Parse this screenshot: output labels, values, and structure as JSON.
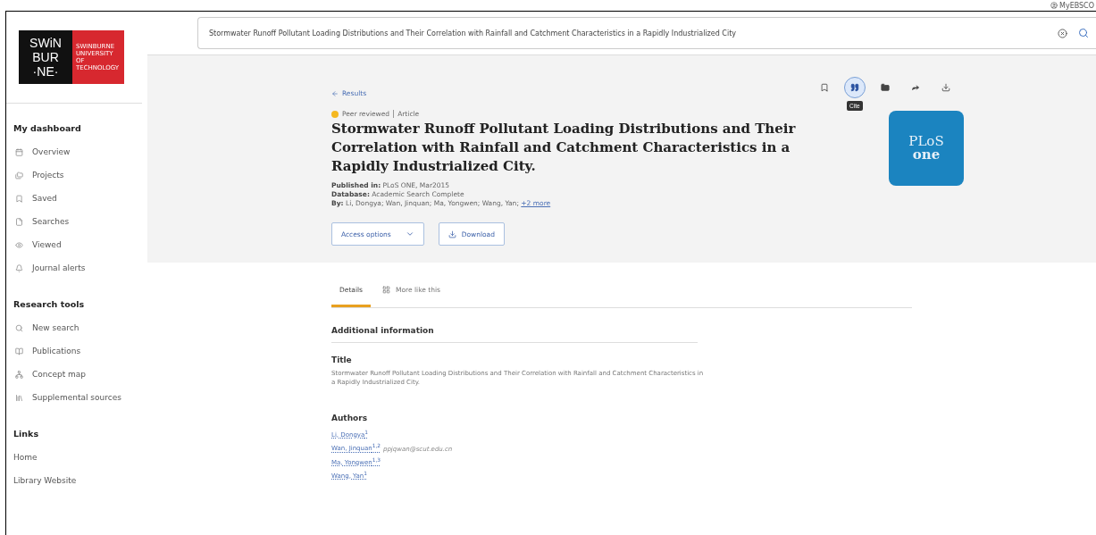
{
  "account": {
    "label": "MyEBSCO"
  },
  "logo": {
    "lines": [
      "SWiN",
      "BUR",
      "·NE·"
    ],
    "tagline": "SWINBURNE UNIVERSITY OF TECHNOLOGY"
  },
  "sidebar": {
    "sections": [
      {
        "heading": "My dashboard",
        "items": [
          {
            "label": "Overview",
            "kind": "tool"
          },
          {
            "label": "Projects",
            "kind": "tool"
          },
          {
            "label": "Saved",
            "kind": "tool"
          },
          {
            "label": "Searches",
            "kind": "tool"
          },
          {
            "label": "Viewed",
            "kind": "tool"
          },
          {
            "label": "Journal alerts",
            "kind": "tool"
          }
        ]
      },
      {
        "heading": "Research tools",
        "items": [
          {
            "label": "New search",
            "kind": "tool"
          },
          {
            "label": "Publications",
            "kind": "tool"
          },
          {
            "label": "Concept map",
            "kind": "tool"
          },
          {
            "label": "Supplemental sources",
            "kind": "tool"
          }
        ]
      },
      {
        "heading": "Links",
        "items": [
          {
            "label": "Home",
            "kind": "link"
          },
          {
            "label": "Library Website",
            "kind": "link"
          }
        ]
      }
    ]
  },
  "search": {
    "value": "Stormwater Runoff Pollutant Loading Distributions and Their Correlation with Rainfall and Catchment Characteristics in a Rapidly Industrialized City"
  },
  "back_link": "Results",
  "actions": [
    {
      "selected": false
    },
    {
      "selected": true
    },
    {
      "selected": false
    },
    {
      "selected": false
    },
    {
      "selected": false
    }
  ],
  "tooltip": "Cite",
  "record": {
    "peer_reviewed": "Peer reviewed",
    "type": "Article",
    "title": "Stormwater Runoff Pollutant Loading Distributions and Their Correlation with Rainfall and Catchment Characteristics in a Rapidly Industrialized City.",
    "meta": [
      {
        "label": "Published in:",
        "value": "PLoS ONE, Mar2015"
      },
      {
        "label": "Database:",
        "value": "Academic Search Complete"
      }
    ],
    "by_label": "By:",
    "authors": "Li, Dongya; Wan, Jinquan; Ma, Yongwen; Wang, Yan;",
    "more": "+2 more",
    "journal_logo": [
      "PLoS",
      "one"
    ]
  },
  "buttons": {
    "access": "Access options",
    "download": "Download"
  },
  "tabs": [
    {
      "label": "Details",
      "selected": true
    },
    {
      "label": "More like this",
      "selected": false
    }
  ],
  "details": {
    "heading": "Additional information",
    "title_label": "Title",
    "title_value": "Stormwater Runoff Pollutant Loading Distributions and Their Correlation with Rainfall and Catchment Characteristics in a Rapidly Industrialized City.",
    "authors_label": "Authors",
    "authors": [
      {
        "name": "Li, Dongya$^{1}$"
      },
      {
        "name": "Wan, Jinquan$^{1,2}$",
        "email": "ppjqwan@scut.edu.cn"
      },
      {
        "name": "Ma, Yongwen$^{1,3}$"
      },
      {
        "name": "Wang, Yan$^{1}$"
      }
    ]
  }
}
